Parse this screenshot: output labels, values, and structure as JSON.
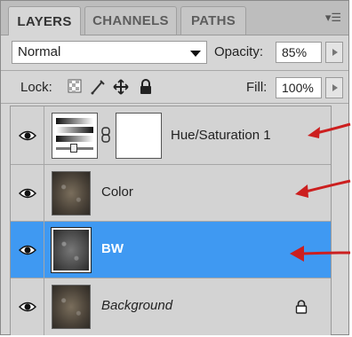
{
  "tabs": [
    {
      "label": "LAYERS",
      "active": true
    },
    {
      "label": "CHANNELS",
      "active": false
    },
    {
      "label": "PATHS",
      "active": false
    }
  ],
  "panel_menu_icon": "panel-menu-icon",
  "blend_mode": "Normal",
  "opacity": {
    "label": "Opacity:",
    "value": "85%"
  },
  "lock": {
    "label": "Lock:",
    "icons": [
      "lock-transparent-icon",
      "lock-image-icon",
      "lock-position-icon",
      "lock-all-icon"
    ]
  },
  "fill": {
    "label": "Fill:",
    "value": "100%"
  },
  "layers": [
    {
      "name": "Hue/Saturation 1",
      "type": "adjustment",
      "visible": true,
      "selected": false,
      "italic": false
    },
    {
      "name": "Color",
      "type": "image",
      "visible": true,
      "selected": false,
      "italic": false
    },
    {
      "name": "BW",
      "type": "image",
      "visible": true,
      "selected": true,
      "italic": false
    },
    {
      "name": "Background",
      "type": "image",
      "visible": true,
      "selected": false,
      "italic": true,
      "locked": true
    }
  ],
  "annotation_arrows": {
    "count": 3,
    "color": "#cc1f1f"
  },
  "colors": {
    "selection": "#3f99f2",
    "panel": "#d6d6d6",
    "arrow": "#cc1f1f"
  }
}
